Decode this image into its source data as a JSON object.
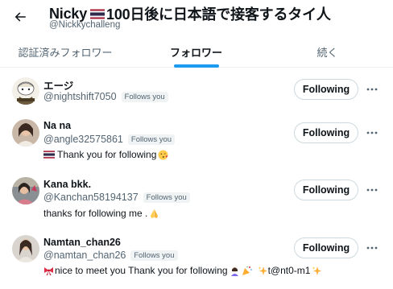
{
  "header": {
    "title": "Nicky 🇹🇭100日後に日本語で接客するタイ人",
    "title_name": "Nicky",
    "title_rest": "100日後に日本語で接客するタイ人",
    "handle": "@Nickkychalleng"
  },
  "tabs": [
    {
      "label": "認証済みフォロワー",
      "active": false
    },
    {
      "label": "フォロワー",
      "active": true
    },
    {
      "label": "続く",
      "active": false
    }
  ],
  "users": [
    {
      "name": "エージ",
      "handle": "@nightshift7050",
      "badge": "Follows you",
      "bio": "",
      "button": "Following",
      "avatar_icon": "cartoon-avatar"
    },
    {
      "name": "Na na",
      "handle": "@angle32575861",
      "badge": "Follows you",
      "bio": "Thank you for following",
      "bio_prefix_icon": "thai-flag",
      "bio_suffix_icon": "kissing-face-emoji",
      "button": "Following",
      "avatar_icon": "photo-avatar"
    },
    {
      "name": "Kana bkk.",
      "handle": "@Kanchan58194137",
      "badge": "Follows you",
      "bio": "thanks for following me .",
      "bio_suffix_icon": "folded-hands-emoji",
      "button": "Following",
      "avatar_icon": "photo-avatar"
    },
    {
      "name": "Namtan_chan26",
      "handle": "@namtan_chan26",
      "badge": "Follows you",
      "bio": "🎀 nice to meet you Thank you for following🙇🏻‍♀️🎉 ✨ t@nt0-m1✨",
      "bio_text": " nice to meet you Thank you for following",
      "bio_tail": " t@nt0-m1",
      "button": "Following",
      "avatar_icon": "photo-avatar"
    }
  ],
  "colors": {
    "text": "#0f1419",
    "secondary": "#536471",
    "accent": "#1d9bf0",
    "border": "#cfd9de",
    "badge_bg": "#eff3f4"
  }
}
